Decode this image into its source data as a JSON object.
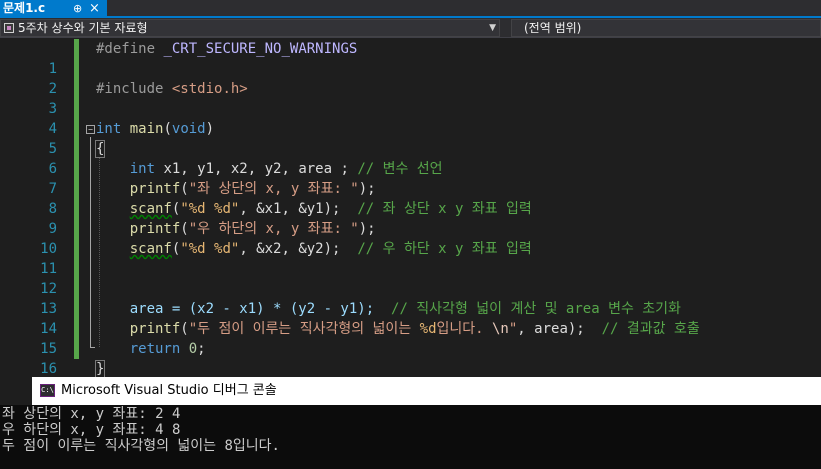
{
  "tab": {
    "title": "문제1.c",
    "pin": "⊕",
    "close": "×"
  },
  "navbar": {
    "scope": "5주차 상수와 기본 자료형",
    "scope_arrow": "▼",
    "member": "(전역 범위)"
  },
  "editor": {
    "line_numbers": [
      "",
      "1",
      "2",
      "3",
      "4",
      "5",
      "6",
      "7",
      "8",
      "9",
      "10",
      "11",
      "12",
      "13",
      "14",
      "15",
      "16"
    ],
    "define": {
      "directive": "#define",
      "name": "_CRT_SECURE_NO_WARNINGS"
    },
    "include": {
      "directive": "#include",
      "header": "<stdio.h>"
    },
    "main_sig": {
      "kw_int": "int",
      "name": "main",
      "params_open": "(",
      "kw_void": "void",
      "params_close": ")"
    },
    "open_brace": "{",
    "close_brace": "}",
    "l7": {
      "kw": "int",
      "decl": "x1, y1, x2, y2, area",
      "semi": " ;",
      "comment": "// 변수 선언"
    },
    "l8": {
      "fn": "printf",
      "open": "(",
      "str": "\"좌 상단의 x, y 좌표: \"",
      "close": ");"
    },
    "l9": {
      "fn": "scanf",
      "open": "(",
      "fmt": "\"%d %d\"",
      "args": ", &x1, &y1",
      "close": ");",
      "comment": "// 좌 상단 x y 좌표 입력"
    },
    "l10": {
      "fn": "printf",
      "open": "(",
      "str": "\"우 하단의 x, y 좌표: \"",
      "close": ");"
    },
    "l11": {
      "fn": "scanf",
      "open": "(",
      "fmt": "\"%d %d\"",
      "args": ", &x2, &y2",
      "close": ");",
      "comment": "// 우 하단 x y 좌표 입력"
    },
    "l13": {
      "expr": "area = (x2 - x1) * (y2 - y1);",
      "comment": "// 직사각형 넓이 계산 및 area 변수 초기화"
    },
    "l14": {
      "fn": "printf",
      "open": "(",
      "str_a": "\"두 점이 이루는 직사각형의 넓이는 ",
      "fmt": "%d",
      "str_b": "입니다. ",
      "esc": "\\n",
      "str_c": "\"",
      "args": ", area",
      "close": ");",
      "comment": "// 결과값 호출"
    },
    "l15": {
      "kw": "return",
      "value": "0",
      "semi": ";"
    }
  },
  "console": {
    "icon_text": "C:\\",
    "title": "Microsoft Visual Studio 디버그 콘솔",
    "lines": [
      "좌 상단의 x, y 좌표: 2 4",
      "우 하단의 x, y 좌표: 4 8",
      "두 점이 이루는 직사각형의 넓이는 8입니다."
    ]
  },
  "colors": {
    "accent": "#007acc",
    "keyword": "#569cd6",
    "string": "#d69d85",
    "comment": "#57a64a",
    "function": "#dcdcaa",
    "line_number": "#2b91af",
    "change_bar": "#57a64a"
  }
}
